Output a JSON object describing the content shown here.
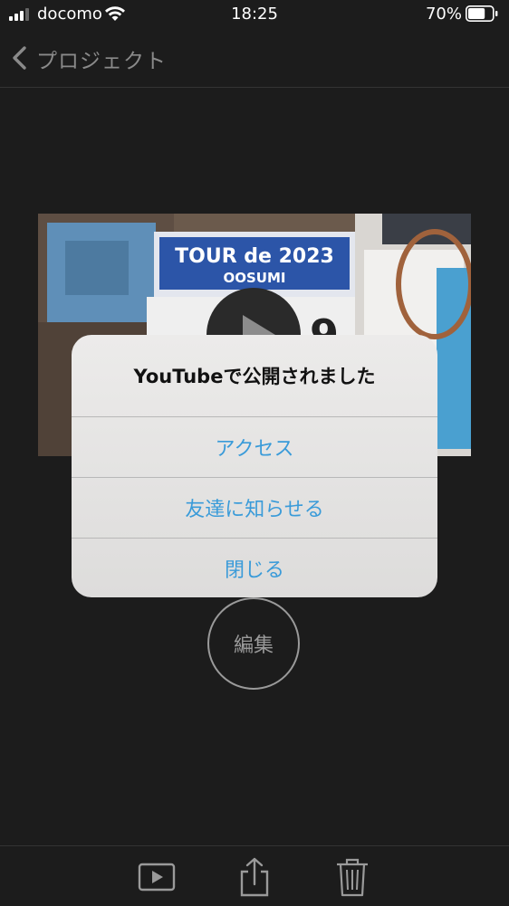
{
  "status_bar": {
    "carrier": "docomo",
    "time": "18:25",
    "battery_percent": "70%",
    "battery_level": 0.7,
    "signal_bars_filled": 3,
    "signal_bars_total": 4
  },
  "nav": {
    "back_label": "プロジェクト",
    "back_icon": "chevron-left-icon"
  },
  "thumbnail": {
    "banner_line1": "TOUR de 2023",
    "banner_line2": "OOSUMI",
    "play_icon": "play-icon"
  },
  "alert": {
    "title": "YouTubeで公開されました",
    "buttons": [
      "アクセス",
      "友達に知らせる",
      "閉じる"
    ]
  },
  "edit_button": {
    "label": "編集"
  },
  "toolbar": {
    "icons": [
      "play-preview-icon",
      "share-icon",
      "trash-icon"
    ]
  },
  "colors": {
    "background": "#1c1c1c",
    "alert_button_text": "#3a9bd9",
    "muted_text": "#8a8a8a"
  }
}
